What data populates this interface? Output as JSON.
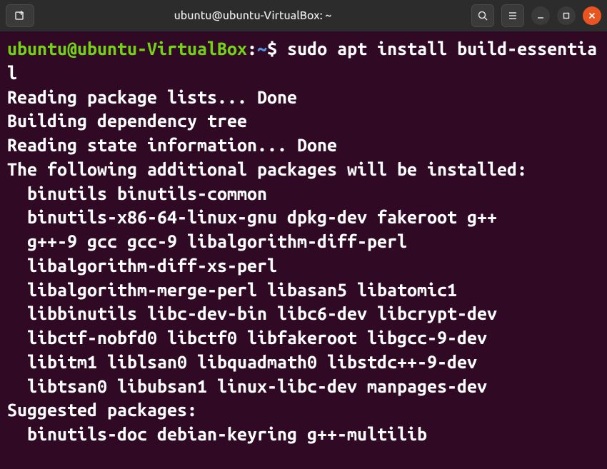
{
  "window": {
    "title": "ubuntu@ubuntu-VirtualBox: ~"
  },
  "prompt": {
    "user_host": "ubuntu@ubuntu-VirtualBox",
    "separator": ":",
    "path": "~",
    "symbol": "$"
  },
  "command": "sudo apt install build-essential",
  "output": {
    "line1": "Reading package lists... Done",
    "line2": "Building dependency tree",
    "line3": "Reading state information... Done",
    "line4": "The following additional packages will be installed:",
    "pkg1": "binutils binutils-common",
    "pkg2": "binutils-x86-64-linux-gnu dpkg-dev fakeroot g++",
    "pkg3": "g++-9 gcc gcc-9 libalgorithm-diff-perl",
    "pkg4": "libalgorithm-diff-xs-perl",
    "pkg5": "libalgorithm-merge-perl libasan5 libatomic1",
    "pkg6": "libbinutils libc-dev-bin libc6-dev libcrypt-dev",
    "pkg7": "libctf-nobfd0 libctf0 libfakeroot libgcc-9-dev",
    "pkg8": "libitm1 liblsan0 libquadmath0 libstdc++-9-dev",
    "pkg9": "libtsan0 libubsan1 linux-libc-dev manpages-dev",
    "suggested_header": "Suggested packages:",
    "suggested1": "binutils-doc debian-keyring g++-multilib"
  }
}
